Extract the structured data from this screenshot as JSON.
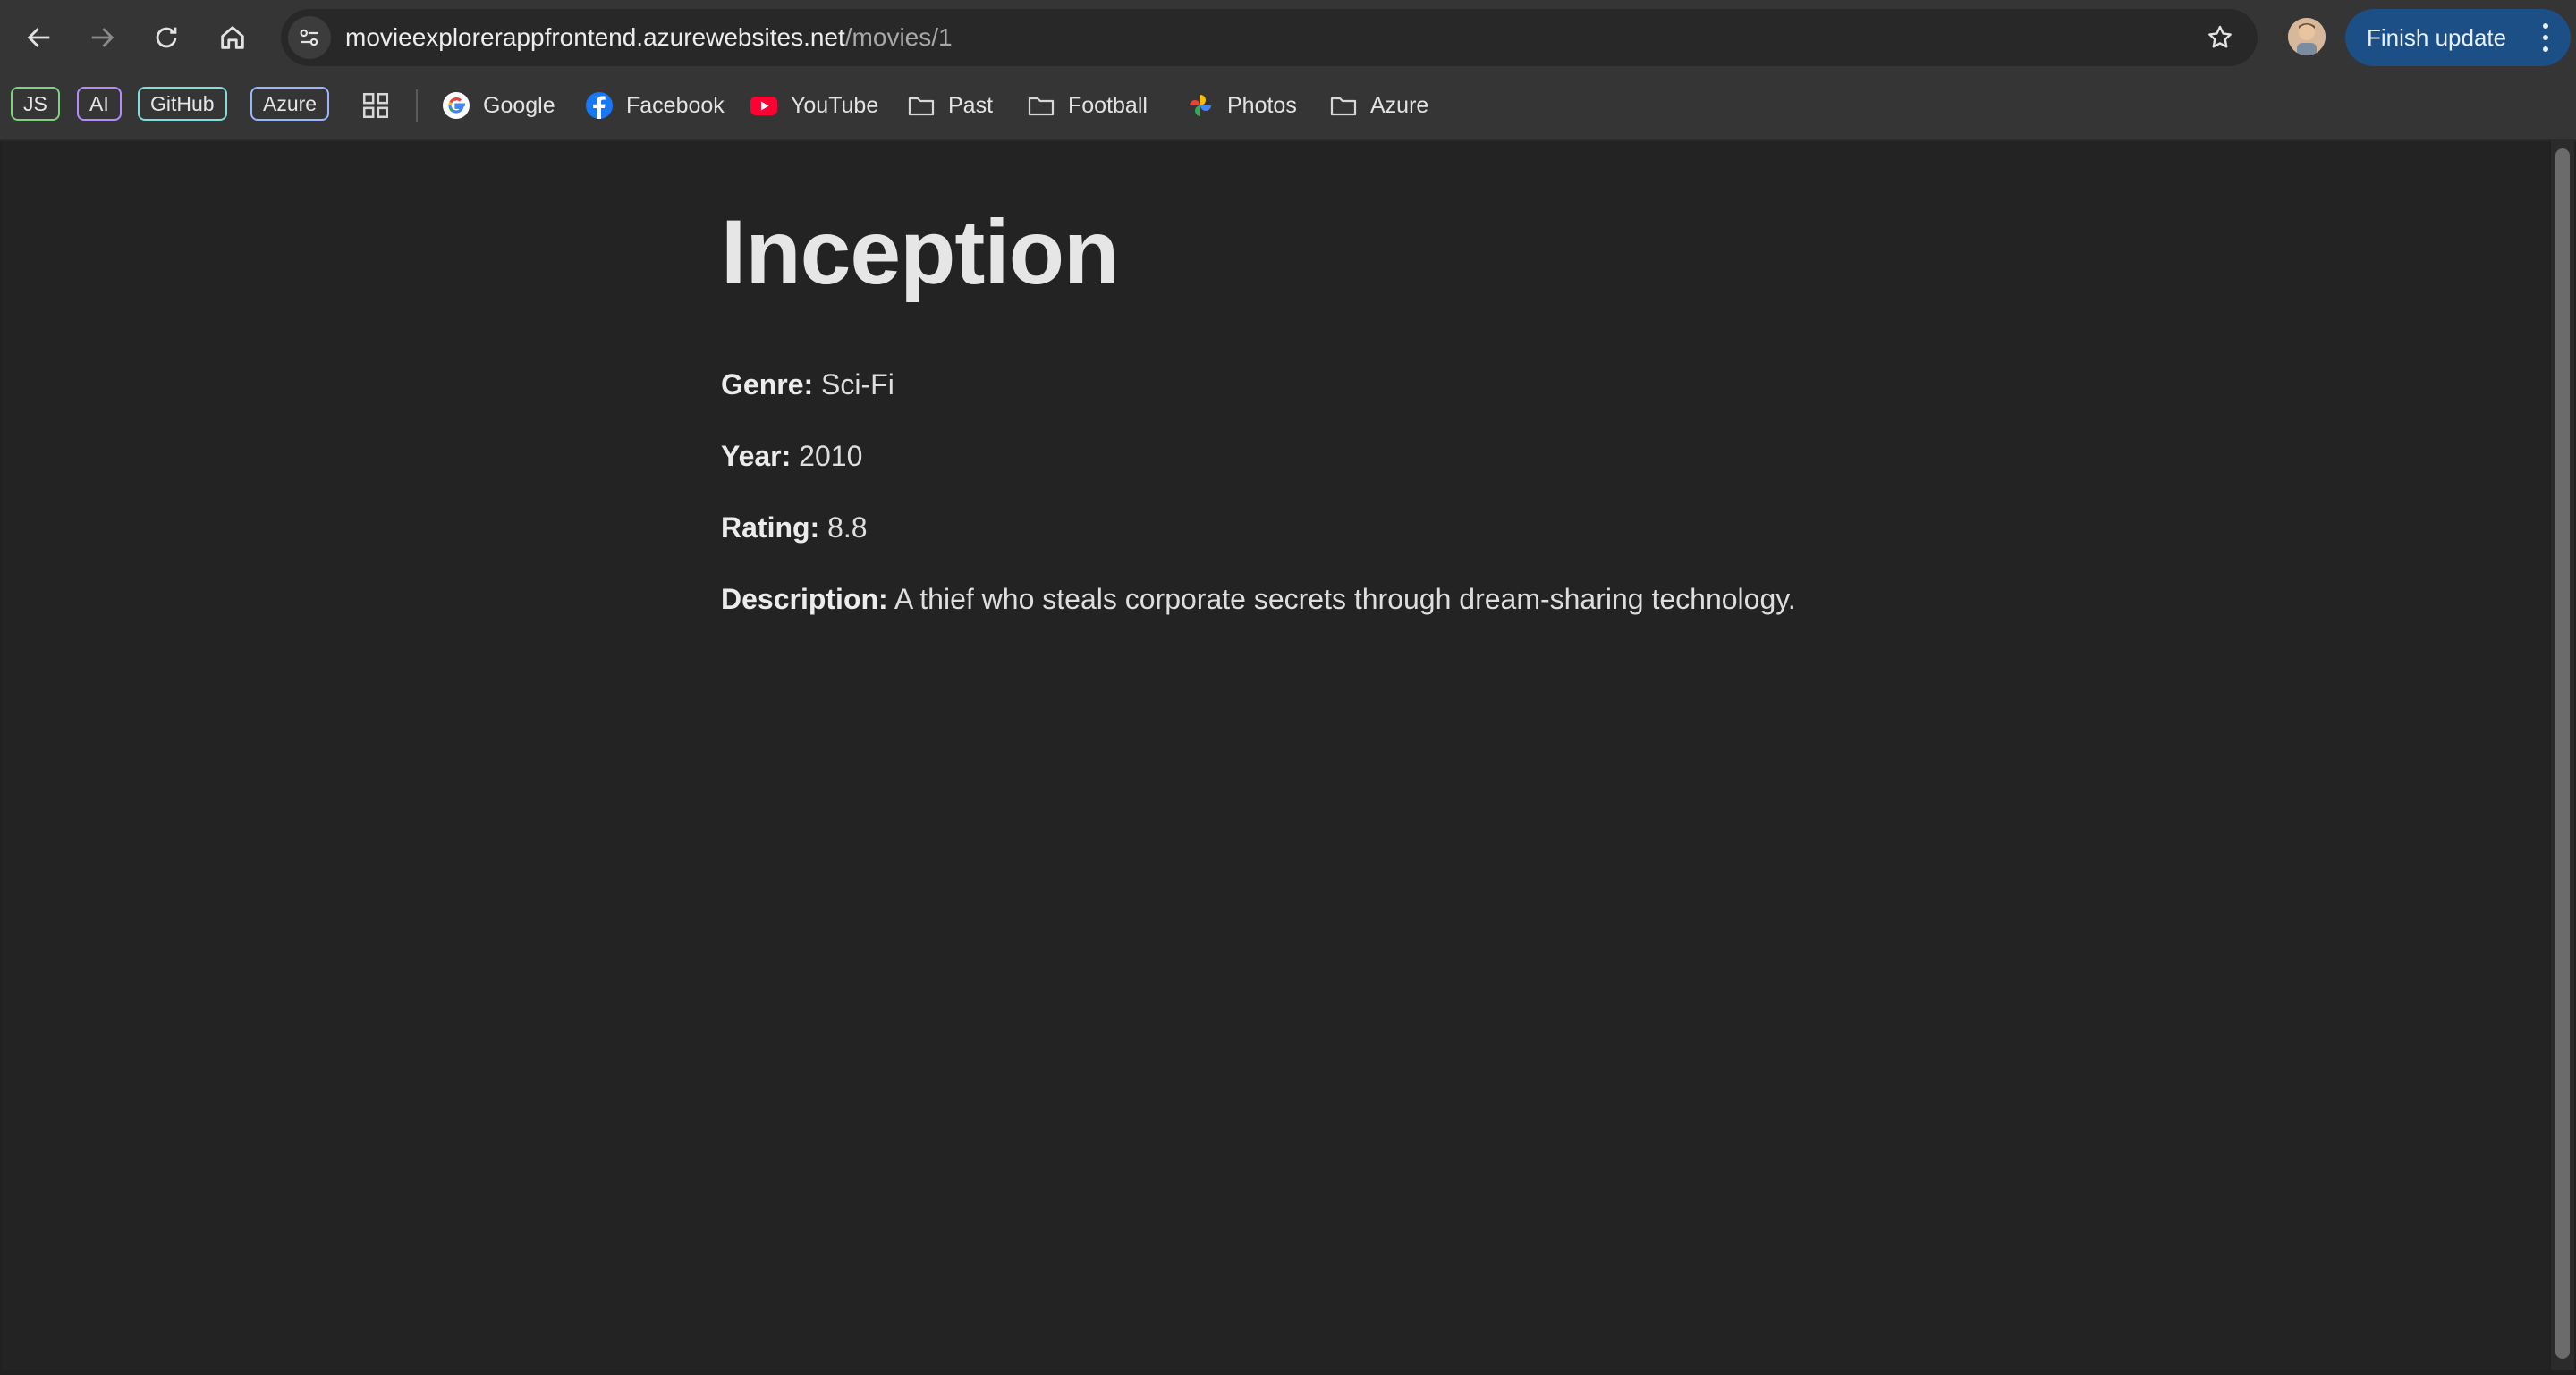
{
  "browser": {
    "url_host": "movieexplorerappfrontend.azurewebsites.net",
    "url_path": "/movies/1",
    "update_button_label": "Finish update"
  },
  "bookmarks": {
    "chips": [
      {
        "label": "JS",
        "color": "#7fd37f"
      },
      {
        "label": "AI",
        "color": "#b58cff"
      },
      {
        "label": "GitHub",
        "color": "#7fdede"
      },
      {
        "label": "Azure",
        "color": "#9ab4ff"
      }
    ],
    "items": [
      {
        "label": "Google",
        "icon": "google-icon"
      },
      {
        "label": "Facebook",
        "icon": "facebook-icon"
      },
      {
        "label": "YouTube",
        "icon": "youtube-icon"
      },
      {
        "label": "Past",
        "icon": "folder-icon"
      },
      {
        "label": "Football",
        "icon": "folder-icon"
      },
      {
        "label": "Photos",
        "icon": "photos-icon"
      },
      {
        "label": "Azure",
        "icon": "folder-icon"
      }
    ]
  },
  "movie": {
    "title": "Inception",
    "genre_label": "Genre:",
    "genre": "Sci-Fi",
    "year_label": "Year:",
    "year": "2010",
    "rating_label": "Rating:",
    "rating": "8.8",
    "description_label": "Description:",
    "description": "A thief who steals corporate secrets through dream-sharing technology."
  },
  "colors": {
    "page_background": "#232323",
    "toolbar_background": "#353535",
    "update_button": "#1b4f85"
  }
}
